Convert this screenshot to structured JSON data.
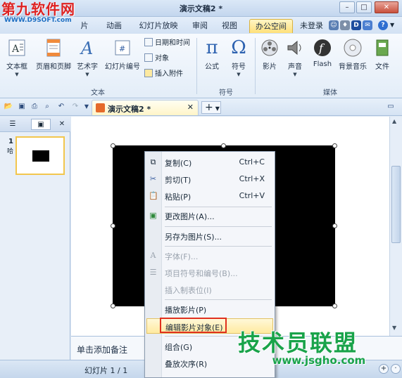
{
  "window": {
    "title": "演示文稿2 *"
  },
  "logo": {
    "text": "第九软件网",
    "url": "WWW.D9SOFT.com"
  },
  "tabs": [
    {
      "label": "片"
    },
    {
      "label": "动画"
    },
    {
      "label": "幻灯片放映"
    },
    {
      "label": "审阅"
    },
    {
      "label": "视图"
    },
    {
      "label": "办公空间"
    }
  ],
  "tabs_right": {
    "login": "未登录"
  },
  "ribbon": {
    "text_group": {
      "label": "文本",
      "buttons": [
        {
          "label": "文本框"
        },
        {
          "label": "页眉和页脚"
        },
        {
          "label": "艺术字"
        },
        {
          "label": "幻灯片编号"
        }
      ],
      "small": [
        {
          "label": "日期和时间"
        },
        {
          "label": "对象"
        },
        {
          "label": "插入附件"
        }
      ]
    },
    "symbol_group": {
      "label": "符号",
      "buttons": [
        {
          "label": "公式",
          "glyph": "π"
        },
        {
          "label": "符号",
          "glyph": "Ω"
        }
      ]
    },
    "media_group": {
      "label": "媒体",
      "buttons": [
        {
          "label": "影片"
        },
        {
          "label": "声音"
        },
        {
          "label": "Flash"
        },
        {
          "label": "背景音乐"
        },
        {
          "label": "文件"
        }
      ]
    }
  },
  "doctab": {
    "title": "演示文稿2 *"
  },
  "slides_panel": {
    "slide_number": "1",
    "side_text": "哈"
  },
  "notes": {
    "placeholder": "单击添加备注"
  },
  "status": {
    "slide_info": "幻灯片 1 / 1"
  },
  "context_menu": {
    "items": [
      {
        "label": "复制(C)",
        "shortcut": "Ctrl+C",
        "icon": "copy-icon"
      },
      {
        "label": "剪切(T)",
        "shortcut": "Ctrl+X",
        "icon": "scissors-icon"
      },
      {
        "label": "粘贴(P)",
        "shortcut": "Ctrl+V",
        "icon": "paste-icon"
      },
      {
        "label": "更改图片(A)...",
        "icon": "change-picture-icon"
      },
      {
        "label": "另存为图片(S)..."
      },
      {
        "label": "字体(F)...",
        "icon": "font-icon",
        "disabled": true
      },
      {
        "label": "项目符号和编号(B)...",
        "icon": "bullets-icon",
        "disabled": true
      },
      {
        "label": "插入制表位(I)",
        "disabled": true
      },
      {
        "label": "播放影片(P)"
      },
      {
        "label": "编辑影片对象(E)",
        "highlighted": true
      },
      {
        "label": "组合(G)"
      },
      {
        "label": "叠放次序(R)"
      }
    ]
  },
  "watermark": {
    "text": "技术员联盟",
    "url": "www.jsgho.com"
  },
  "colors": {
    "accent_tab": "#ffe07a",
    "highlight_box": "#e0301e",
    "watermark_green": "#19a34a",
    "logo_red": "#d22222"
  }
}
